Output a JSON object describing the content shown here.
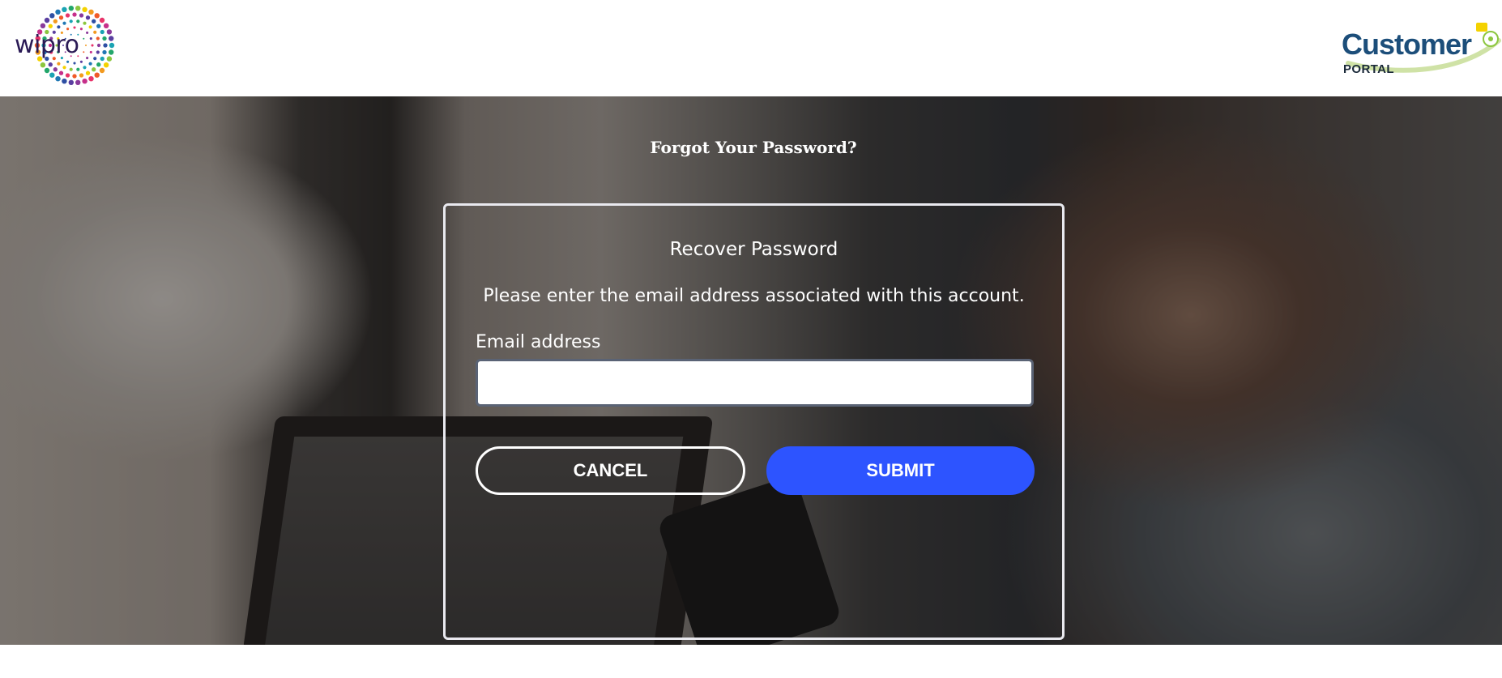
{
  "header": {
    "brand_logo_text": "wipro",
    "portal_title": "Customer",
    "portal_subtitle": "PORTAL"
  },
  "page": {
    "heading": "Forgot Your Password?"
  },
  "recover_card": {
    "title": "Recover Password",
    "description": "Please enter the email address associated with this account.",
    "email_label": "Email address",
    "email_value": "",
    "email_placeholder": "",
    "cancel_label": "CANCEL",
    "submit_label": "SUBMIT"
  },
  "colors": {
    "submit_button": "#2d54ff",
    "portal_title": "#1c4e7a",
    "wipro_text": "#2a1a55"
  }
}
